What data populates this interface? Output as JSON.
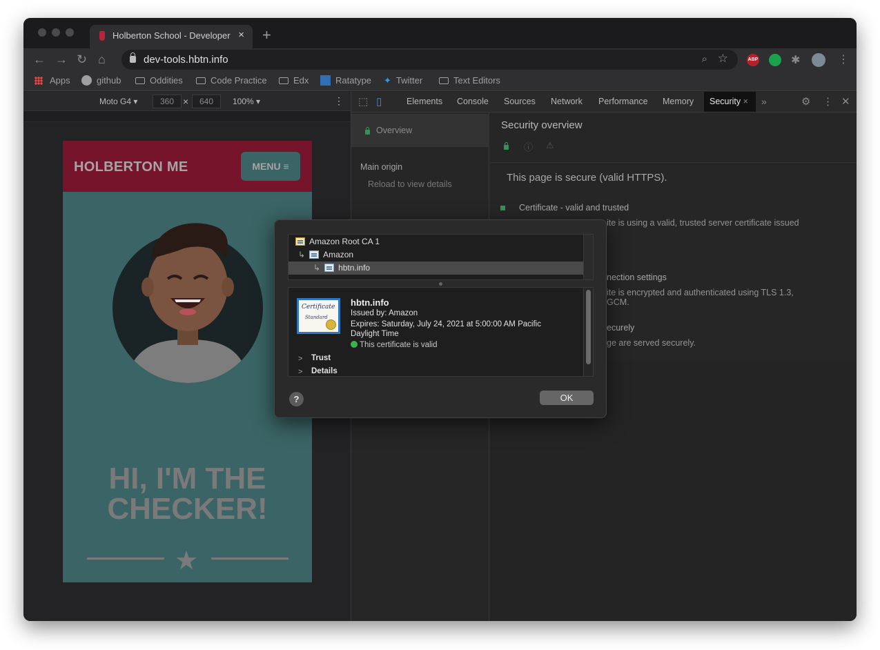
{
  "browser": {
    "tab_title": "Holberton School - Developer",
    "tab_close": "×",
    "new_tab": "+",
    "url": "dev-tools.hbtn.info",
    "extension_abp": "ABP",
    "bookmarks": {
      "apps": "Apps",
      "github": "github",
      "oddities": "Oddities",
      "code_practice": "Code Practice",
      "edx": "Edx",
      "ratatype": "Ratatype",
      "twitter": "Twitter",
      "text_editors": "Text Editors"
    }
  },
  "device_toolbar": {
    "device": "Moto G4",
    "width": "360",
    "height": "640",
    "times": "×",
    "zoom": "100%"
  },
  "site": {
    "brand": "HOLBERTON ME",
    "menu": "MENU ≡",
    "hero_line1": "HI, I'M THE",
    "hero_line2": "CHECKER!"
  },
  "devtools": {
    "tabs": [
      "Elements",
      "Console",
      "Sources",
      "Network",
      "Performance",
      "Memory",
      "Security"
    ],
    "more": "»",
    "active_close": "×",
    "sidebar": {
      "overview": "Overview",
      "main_origin": "Main origin",
      "reload": "Reload to view details"
    },
    "security": {
      "title": "Security overview",
      "secure_message": "This page is secure (valid HTTPS).",
      "cert_heading": "Certificate - valid and trusted",
      "cert_text": "ite is using a valid, trusted server certificate issued",
      "conn_heading": "nection settings",
      "conn_text_1": "ite is encrypted and authenticated using TLS 1.3,",
      "conn_text_2": "GCM.",
      "res_heading": "ecurely",
      "res_text": "ge are served securely."
    }
  },
  "cert_dialog": {
    "chain": [
      {
        "label": "Amazon Root CA 1"
      },
      {
        "label": "Amazon"
      },
      {
        "label": "hbtn.info"
      }
    ],
    "cert_image_text_1": "Certificate",
    "cert_image_text_2": "Standard",
    "name": "hbtn.info",
    "issued_by": "Issued by: Amazon",
    "expires_line1": "Expires: Saturday, July 24, 2021 at 5:00:00 AM Pacific",
    "expires_line2": "Daylight Time",
    "valid": "This certificate is valid",
    "trust": "Trust",
    "details": "Details",
    "help": "?",
    "ok": "OK"
  },
  "colors": {
    "site_header": "#75142a",
    "site_body": "#3a6465",
    "secure_green": "#3b8f5a"
  }
}
